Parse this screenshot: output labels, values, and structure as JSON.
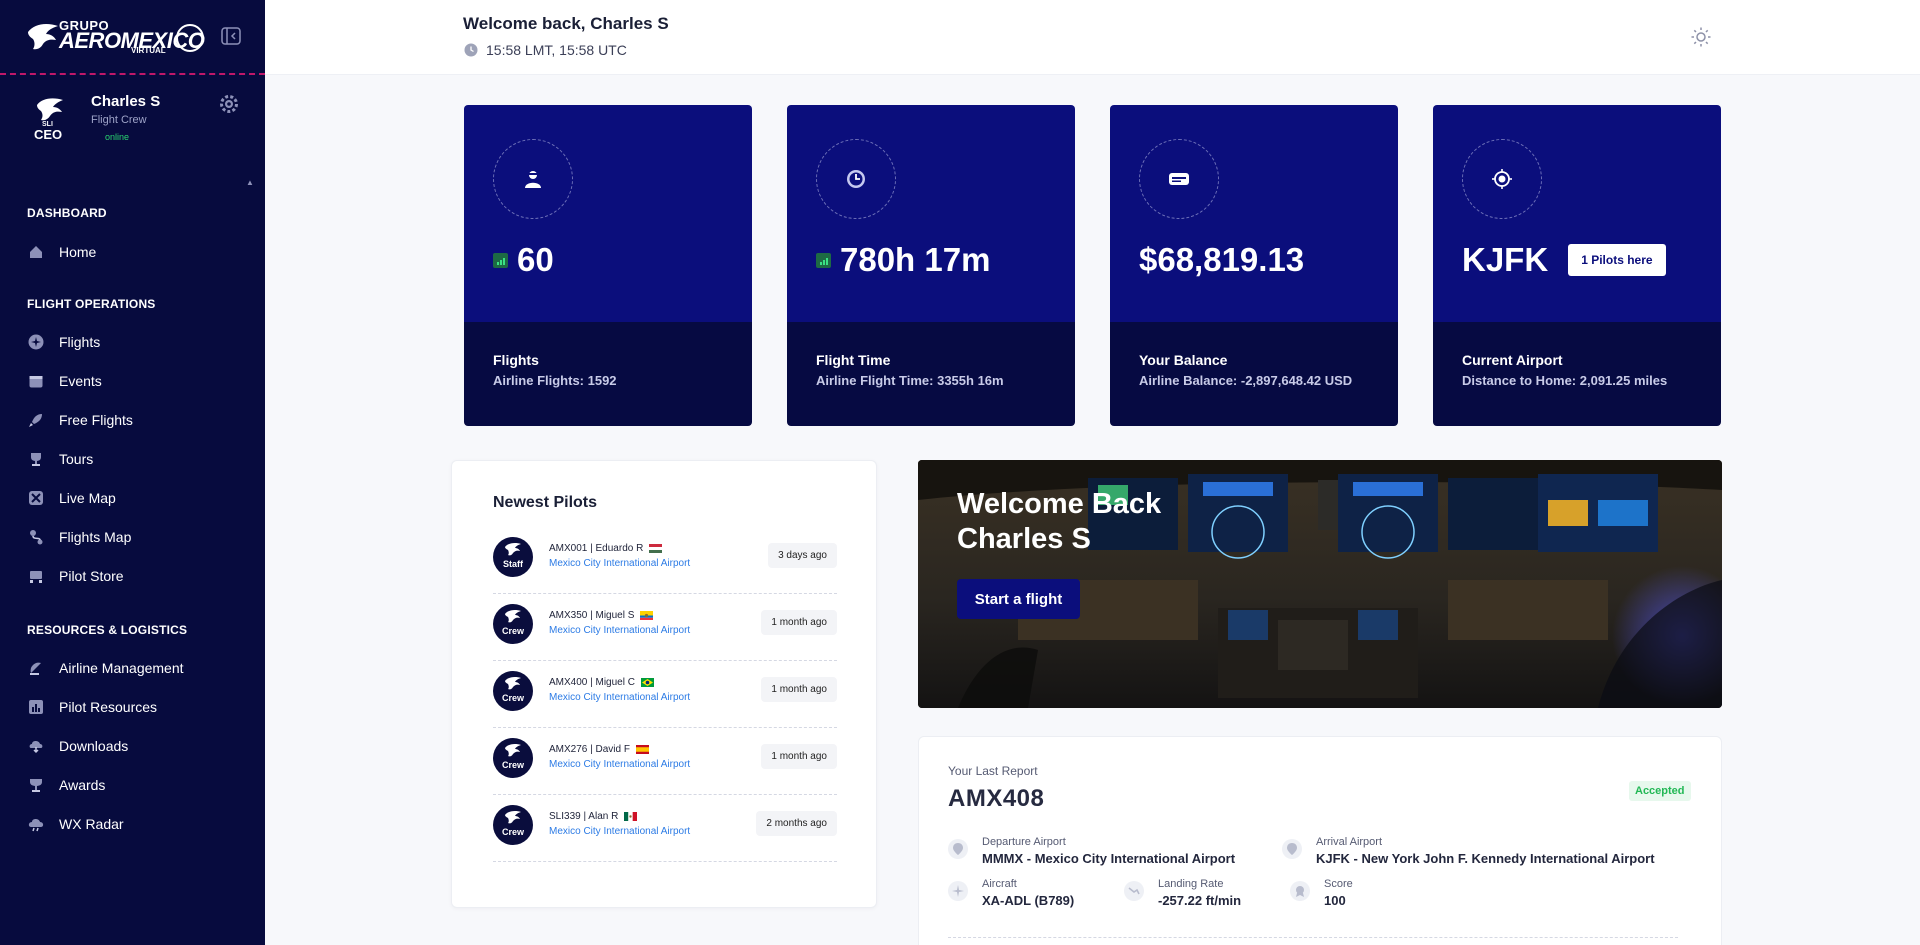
{
  "brand": {
    "line1": "GRUPO",
    "line2": "AEROMEXICO",
    "line3": "VIRTUAL"
  },
  "user": {
    "name": "Charles S",
    "role": "Flight Crew",
    "status": "online",
    "avatar_tag_small": "SLI",
    "avatar_tag_large": "CEO"
  },
  "nav": {
    "sections": [
      "DASHBOARD",
      "FLIGHT OPERATIONS",
      "RESOURCES & LOGISTICS"
    ],
    "dashboard": [
      {
        "label": "Home",
        "icon": "home-icon"
      }
    ],
    "operations": [
      {
        "label": "Flights",
        "icon": "plane-icon"
      },
      {
        "label": "Events",
        "icon": "calendar-icon"
      },
      {
        "label": "Free Flights",
        "icon": "rocket-icon"
      },
      {
        "label": "Tours",
        "icon": "trophy-icon"
      },
      {
        "label": "Live Map",
        "icon": "map-icon"
      },
      {
        "label": "Flights Map",
        "icon": "route-icon"
      },
      {
        "label": "Pilot Store",
        "icon": "cart-icon"
      }
    ],
    "resources": [
      {
        "label": "Airline Management",
        "icon": "satellite-icon"
      },
      {
        "label": "Pilot Resources",
        "icon": "chart-icon"
      },
      {
        "label": "Downloads",
        "icon": "cloud-download-icon"
      },
      {
        "label": "Awards",
        "icon": "award-icon"
      },
      {
        "label": "WX Radar",
        "icon": "cloud-icon"
      }
    ]
  },
  "header": {
    "welcome": "Welcome back, Charles S",
    "time": "15:58 LMT, 15:58 UTC"
  },
  "stats": [
    {
      "value": "60",
      "label": "Flights",
      "sub": "Airline Flights: 1592"
    },
    {
      "value": "780h 17m",
      "label": "Flight Time",
      "sub": "Airline Flight Time: 3355h 16m"
    },
    {
      "value": "$68,819.13",
      "label": "Your Balance",
      "sub": "Airline Balance: -2,897,648.42 USD"
    },
    {
      "value": "KJFK",
      "label": "Current Airport",
      "sub": "Distance to Home: 2,091.25 miles",
      "button": "1 Pilots here"
    }
  ],
  "newest_pilots": {
    "title": "Newest Pilots",
    "items": [
      {
        "tag": "Staff",
        "name": "AMX001 | Eduardo R",
        "airport": "Mexico City International Airport",
        "ago": "3 days ago",
        "flag": "hungary"
      },
      {
        "tag": "Crew",
        "name": "AMX350 | Miguel S",
        "airport": "Mexico City International Airport",
        "ago": "1 month ago",
        "flag": "ecuador"
      },
      {
        "tag": "Crew",
        "name": "AMX400 | Miguel C",
        "airport": "Mexico City International Airport",
        "ago": "1 month ago",
        "flag": "brazil"
      },
      {
        "tag": "Crew",
        "name": "AMX276 | David F",
        "airport": "Mexico City International Airport",
        "ago": "1 month ago",
        "flag": "spain"
      },
      {
        "tag": "Crew",
        "name": "SLI339 | Alan R",
        "airport": "Mexico City International Airport",
        "ago": "2 months ago",
        "flag": "mexico"
      }
    ]
  },
  "hero": {
    "line1": "Welcome Back",
    "line2": "Charles S",
    "button": "Start a flight"
  },
  "report": {
    "label": "Your Last Report",
    "id": "AMX408",
    "status": "Accepted",
    "departure_label": "Departure Airport",
    "departure": "MMMX - Mexico City International Airport",
    "arrival_label": "Arrival Airport",
    "arrival": "KJFK - New York John F. Kennedy International Airport",
    "aircraft_label": "Aircraft",
    "aircraft": "XA-ADL (B789)",
    "landing_label": "Landing Rate",
    "landing": "-257.22 ft/min",
    "score_label": "Score",
    "score": "100"
  },
  "colors": {
    "sidebar": "#070b3e",
    "card_upper": "#0b0e7c",
    "card_lower": "#060a42",
    "accent_pink": "#c0186a",
    "online": "#29d46f",
    "accepted": "#22b855",
    "link": "#2c7be5"
  }
}
